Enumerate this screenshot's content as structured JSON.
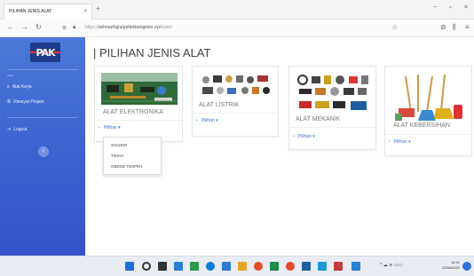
{
  "browser": {
    "tab_title": "PILIHAN JENIS ALAT",
    "tab_close": "×",
    "new_tab": "+",
    "url_prefix": "https://",
    "url_main": "achmarfajru/poltekbangmks.xyz",
    "url_path": "/user/",
    "controls": {
      "minimize": "−",
      "restore": "▫",
      "close": "×"
    },
    "icons": {
      "back": "←",
      "forward": "→",
      "reload": "↻",
      "star": "☆",
      "shield": "⊘",
      "library": "⫼",
      "menu": "≡"
    }
  },
  "sidebar": {
    "logo_text": "PAK",
    "section_heading": "menu",
    "items": [
      {
        "label": "Alat Kerja",
        "icon": "≡"
      },
      {
        "label": "Riwayat Pinjam",
        "icon": "≣"
      },
      {
        "label": "Logout",
        "icon": "⇥"
      }
    ],
    "toggle_icon": "‹"
  },
  "main": {
    "page_title": "| PILIHAN JENIS ALAT",
    "cards": [
      {
        "title": "ALAT ELEKTRONIKA",
        "action": "Pilihan ▾"
      },
      {
        "title": "ALAT LISTRIK",
        "action": "Pilihan ▾"
      },
      {
        "title": "ALAT MEKANIK",
        "action": "Pilihan ▾"
      },
      {
        "title": "ALAT KEBERSIHAN",
        "action": "Pilihan ▾"
      }
    ],
    "dropdown_items": [
      "SOLDER",
      "TIMAH",
      "OBENG TESPEN"
    ]
  },
  "taskbar": {
    "tray": "^ ☁ ≋ ◁ ▭",
    "time": "14:41",
    "date": "22/06/2022"
  },
  "colors": {
    "sidebar": "#3a5fcf",
    "link": "#3b6fd8",
    "title": "#444444"
  }
}
